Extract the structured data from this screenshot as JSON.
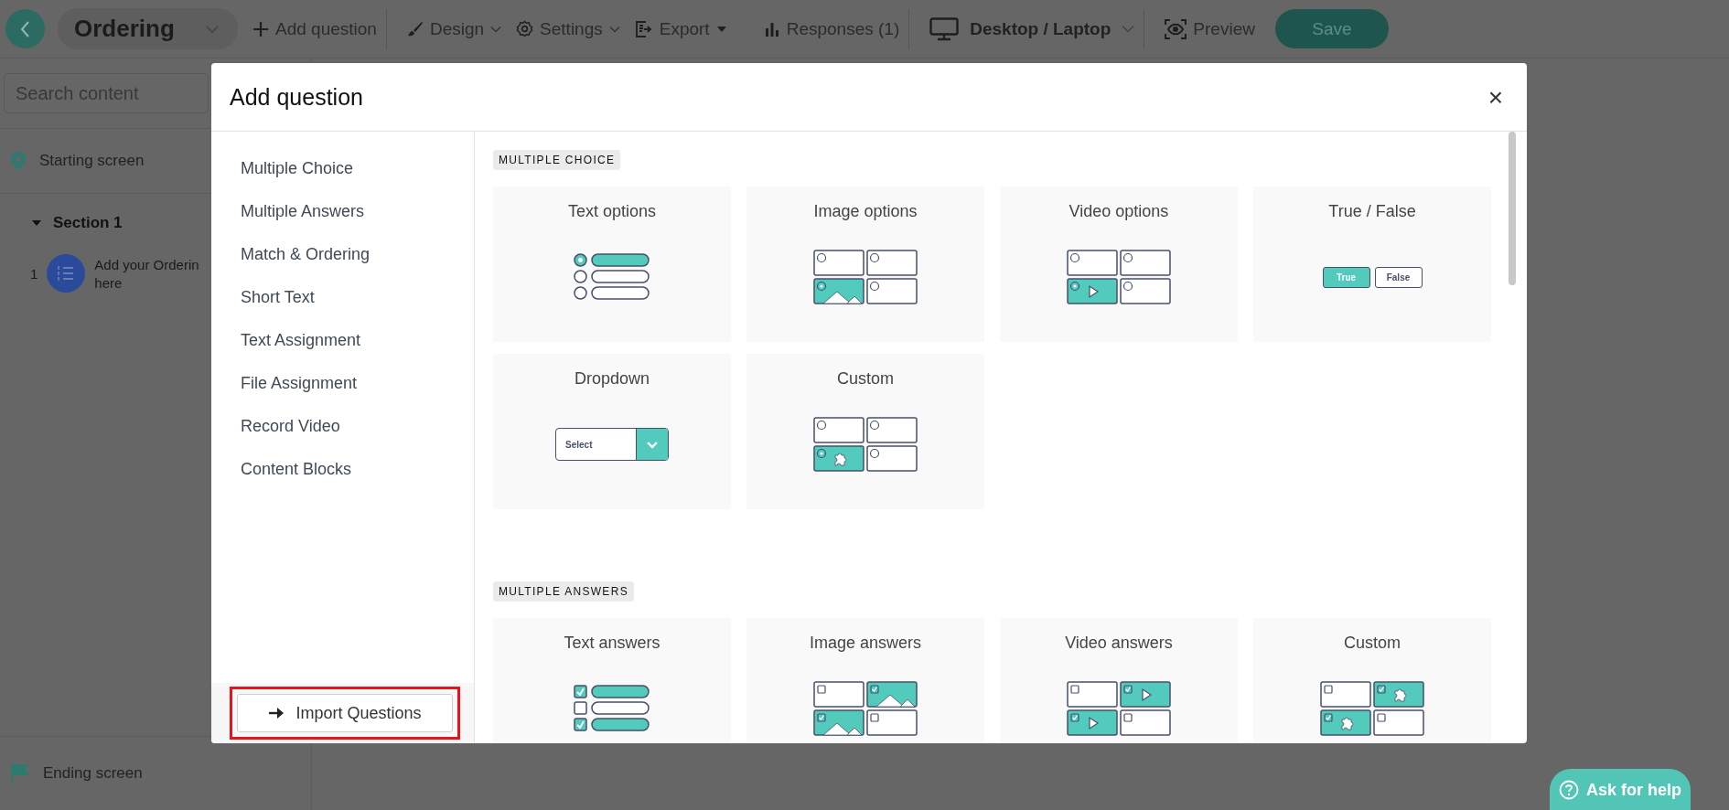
{
  "toolbar": {
    "title": "Ordering",
    "items": [
      {
        "label": "Add question",
        "kind": "add"
      },
      {
        "label": "Design",
        "kind": "design"
      },
      {
        "label": "Settings",
        "kind": "settings"
      },
      {
        "label": "Export",
        "kind": "export"
      },
      {
        "label": "Responses (1)",
        "kind": "responses"
      }
    ],
    "device": "Desktop / Laptop",
    "preview": "Preview",
    "save": "Save"
  },
  "sidebar": {
    "search_placeholder": "Search content",
    "starting_screen": "Starting screen",
    "section": {
      "title": "Section 1",
      "expanded": true,
      "items": [
        {
          "number": "1",
          "lines": [
            "Add your Orderin",
            "here"
          ]
        }
      ]
    },
    "ending_screen": "Ending screen"
  },
  "modal": {
    "title": "Add question",
    "close": "×",
    "categories": [
      {
        "label": "Multiple Choice"
      },
      {
        "label": "Multiple Answers"
      },
      {
        "label": "Match & Ordering"
      },
      {
        "label": "Short Text"
      },
      {
        "label": "Text Assignment"
      },
      {
        "label": "File Assignment"
      },
      {
        "label": "Record Video"
      },
      {
        "label": "Content Blocks"
      }
    ],
    "import_button": "Import Questions",
    "sections": [
      {
        "title": "MULTIPLE CHOICE",
        "cards": [
          {
            "title": "Text options",
            "kind": "option-list",
            "multi": false,
            "options": [
              {
                "selected": true
              },
              {
                "selected": false
              },
              {
                "selected": false
              }
            ]
          },
          {
            "title": "Image options",
            "kind": "image-grid",
            "multi": false,
            "tiles": [
              {
                "selected": false
              },
              {
                "selected": false
              },
              {
                "selected": true
              },
              {
                "selected": false
              }
            ]
          },
          {
            "title": "Video options",
            "kind": "video-grid",
            "multi": false,
            "tiles": [
              {
                "selected": false
              },
              {
                "selected": false
              },
              {
                "selected": true
              },
              {
                "selected": false
              }
            ]
          },
          {
            "title": "True / False",
            "kind": "toggle-pair",
            "options": [
              {
                "label": "True",
                "selected": true
              },
              {
                "label": "False",
                "selected": false
              }
            ]
          },
          {
            "title": "Dropdown",
            "kind": "select-box",
            "placeholder": "Select"
          },
          {
            "title": "Custom",
            "kind": "puzzle-grid",
            "multi": false,
            "tiles": [
              {
                "selected": false
              },
              {
                "selected": false
              },
              {
                "selected": true
              },
              {
                "selected": false
              }
            ]
          }
        ]
      },
      {
        "title": "MULTIPLE ANSWERS",
        "cards": [
          {
            "title": "Text answers",
            "kind": "option-list",
            "multi": true,
            "options": [
              {
                "selected": true
              },
              {
                "selected": false
              },
              {
                "selected": true
              }
            ]
          },
          {
            "title": "Image answers",
            "kind": "image-grid",
            "multi": true,
            "tiles": [
              {
                "selected": false
              },
              {
                "selected": true
              },
              {
                "selected": true
              },
              {
                "selected": false
              }
            ]
          },
          {
            "title": "Video answers",
            "kind": "video-grid",
            "multi": true,
            "tiles": [
              {
                "selected": false
              },
              {
                "selected": true
              },
              {
                "selected": true
              },
              {
                "selected": false
              }
            ]
          },
          {
            "title": "Custom",
            "kind": "puzzle-grid",
            "multi": true,
            "tiles": [
              {
                "selected": false
              },
              {
                "selected": true
              },
              {
                "selected": true
              },
              {
                "selected": false
              }
            ]
          }
        ]
      }
    ]
  },
  "help_button": "Ask for help"
}
